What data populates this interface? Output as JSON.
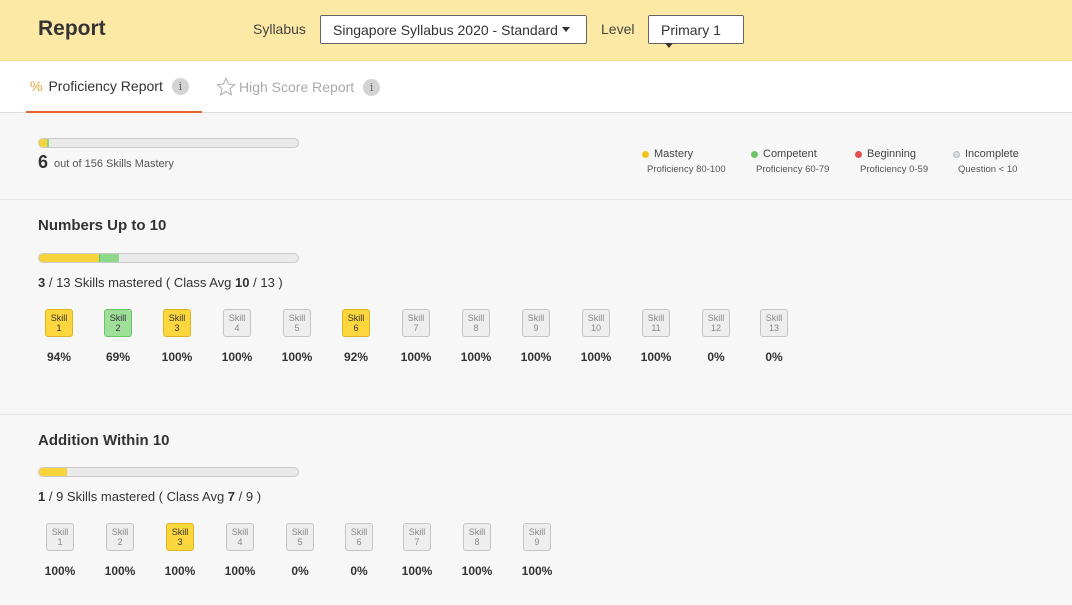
{
  "header": {
    "title": "Report",
    "syllabus_label": "Syllabus",
    "syllabus_value": "Singapore Syllabus 2020 - Standard",
    "level_label": "Level",
    "level_value": "Primary 1",
    "background_color": "#fde9a6"
  },
  "tabs": [
    {
      "icon": "%",
      "label": "Proficiency Report",
      "active": true,
      "info": "i"
    },
    {
      "icon": "star-icon",
      "label": "High Score Report",
      "active": false,
      "info": "i"
    }
  ],
  "summary": {
    "mastered_count": "6",
    "mastered_text": "out of 156 Skills Mastery",
    "progress": {
      "mastery_fraction": 0.03,
      "competent_fraction": 0.01
    }
  },
  "legend": [
    {
      "label": "Mastery",
      "desc_prefix": "Proficiency ",
      "desc_value": "80-100",
      "color": "#f0c419"
    },
    {
      "label": "Competent",
      "desc_prefix": "Proficiency ",
      "desc_value": "60-79",
      "color": "#6dc466"
    },
    {
      "label": "Beginning",
      "desc_prefix": "Proficiency ",
      "desc_value": "0-59",
      "color": "#e05252"
    },
    {
      "label": "Incomplete",
      "desc_prefix": "Question < ",
      "desc_value": "10",
      "color": "#d8dce0"
    }
  ],
  "sections": [
    {
      "title": "Numbers Up to 10",
      "mastered": "3",
      "total": "13",
      "mid_text": " Skills mastered ( Class Avg ",
      "class_avg": "10",
      "class_total": "13",
      "progress": {
        "mastery_fraction": 0.23,
        "competent_fraction": 0.08
      },
      "skills": [
        {
          "name": "Skill",
          "num": "1",
          "status": "mastery",
          "pct": "94%"
        },
        {
          "name": "Skill",
          "num": "2",
          "status": "competent",
          "pct": "69%"
        },
        {
          "name": "Skill",
          "num": "3",
          "status": "mastery",
          "pct": "100%"
        },
        {
          "name": "Skill",
          "num": "4",
          "status": "incomplete",
          "pct": "100%"
        },
        {
          "name": "Skill",
          "num": "5",
          "status": "incomplete",
          "pct": "100%"
        },
        {
          "name": "Skill",
          "num": "6",
          "status": "mastery",
          "pct": "92%"
        },
        {
          "name": "Skill",
          "num": "7",
          "status": "incomplete",
          "pct": "100%"
        },
        {
          "name": "Skill",
          "num": "8",
          "status": "incomplete",
          "pct": "100%"
        },
        {
          "name": "Skill",
          "num": "9",
          "status": "incomplete",
          "pct": "100%"
        },
        {
          "name": "Skill",
          "num": "10",
          "status": "incomplete",
          "pct": "100%"
        },
        {
          "name": "Skill",
          "num": "11",
          "status": "incomplete",
          "pct": "100%"
        },
        {
          "name": "Skill",
          "num": "12",
          "status": "incomplete",
          "pct": "0%"
        },
        {
          "name": "Skill",
          "num": "13",
          "status": "incomplete",
          "pct": "0%"
        }
      ]
    },
    {
      "title": "Addition Within 10",
      "mastered": "1",
      "total": "9",
      "mid_text": " Skills mastered ( Class Avg ",
      "class_avg": "7",
      "class_total": "9",
      "progress": {
        "mastery_fraction": 0.11,
        "competent_fraction": 0.0
      },
      "skills": [
        {
          "name": "Skill",
          "num": "1",
          "status": "incomplete",
          "pct": "100%"
        },
        {
          "name": "Skill",
          "num": "2",
          "status": "incomplete",
          "pct": "100%"
        },
        {
          "name": "Skill",
          "num": "3",
          "status": "mastery",
          "pct": "100%"
        },
        {
          "name": "Skill",
          "num": "4",
          "status": "incomplete",
          "pct": "100%"
        },
        {
          "name": "Skill",
          "num": "5",
          "status": "incomplete",
          "pct": "0%"
        },
        {
          "name": "Skill",
          "num": "6",
          "status": "incomplete",
          "pct": "0%"
        },
        {
          "name": "Skill",
          "num": "7",
          "status": "incomplete",
          "pct": "100%"
        },
        {
          "name": "Skill",
          "num": "8",
          "status": "incomplete",
          "pct": "100%"
        },
        {
          "name": "Skill",
          "num": "9",
          "status": "incomplete",
          "pct": "100%"
        }
      ]
    }
  ]
}
